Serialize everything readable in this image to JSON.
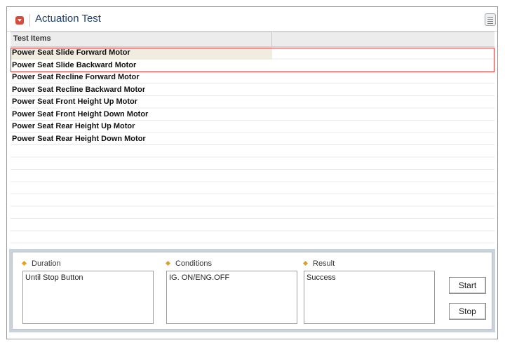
{
  "window": {
    "title": "Actuation Test",
    "title_icon": "collapse-arrow-icon",
    "menu_icon": "list-menu-icon"
  },
  "list": {
    "column_header": "Test Items",
    "items": [
      {
        "label": "Power Seat Slide Forward Motor"
      },
      {
        "label": "Power Seat Slide Backward Motor"
      },
      {
        "label": "Power Seat Recline Forward Motor"
      },
      {
        "label": "Power Seat Recline Backward Motor"
      },
      {
        "label": "Power Seat Front Height Up Motor"
      },
      {
        "label": "Power Seat Front Height Down Motor"
      },
      {
        "label": "Power Seat Rear Height Up Motor"
      },
      {
        "label": "Power Seat Rear Height Down Motor"
      }
    ]
  },
  "details": {
    "duration_label": "Duration",
    "duration_value": "Until Stop Button",
    "conditions_label": "Conditions",
    "conditions_value": "IG. ON/ENG.OFF",
    "result_label": "Result",
    "result_value": "Success"
  },
  "buttons": {
    "start": "Start",
    "stop": "Stop"
  },
  "colors": {
    "highlight_border": "#e23a3a",
    "title_text": "#1f3e6e",
    "title_icon_bg": "#d94a3b",
    "label_diamond": "#e0a020",
    "panel_bg": "#c9d3de"
  }
}
